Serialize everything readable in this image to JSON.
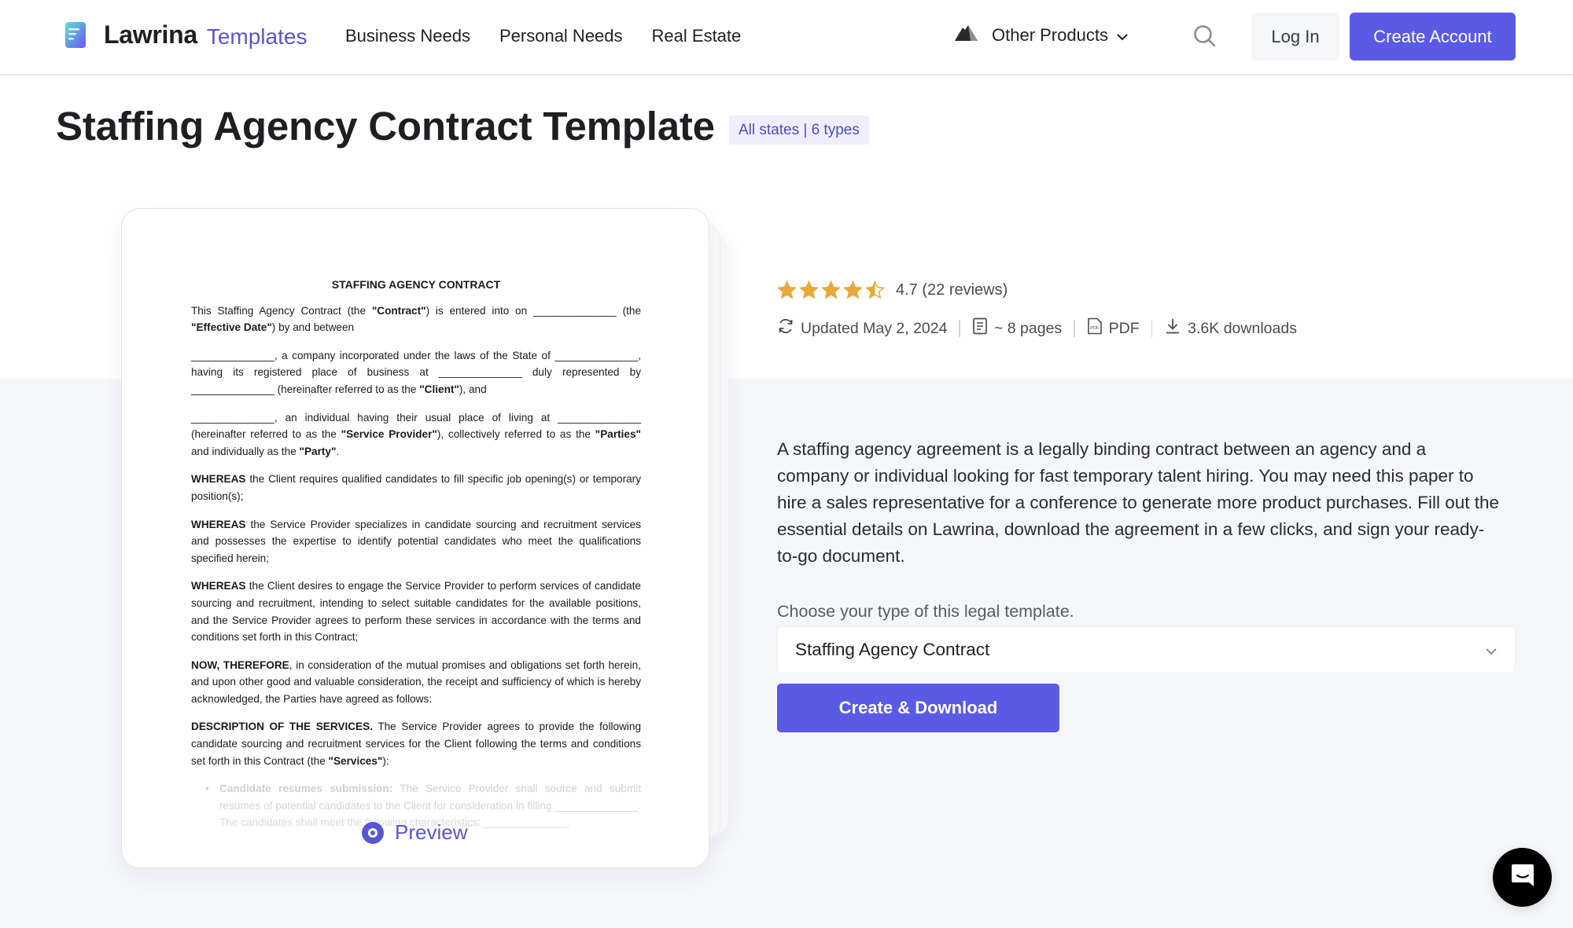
{
  "header": {
    "brand": "Lawrina",
    "brand_sub": "Templates",
    "nav": [
      "Business Needs",
      "Personal Needs",
      "Real Estate"
    ],
    "other_products": "Other Products",
    "login": "Log In",
    "create_account": "Create Account",
    "icons": {
      "logo": "document-logo-icon",
      "other_products": "mountain-icon",
      "chevron": "chevron-down-icon",
      "search": "search-icon"
    }
  },
  "page": {
    "title": "Staffing Agency Contract Template",
    "badge": "All states | 6 types"
  },
  "document_preview": {
    "title": "STAFFING AGENCY CONTRACT",
    "paragraphs": [
      "This Staffing Agency Contract (the \"Contract\") is entered into on ______________ (the \"Effective Date\") by and between",
      "______________, a company incorporated under the laws of the State of ______________, having its registered place of business at ______________ duly represented by ______________ (hereinafter referred to as the \"Client\"), and",
      "______________, an individual having their usual place of living at ______________ (hereinafter referred to as the \"Service Provider\"), collectively referred to as the \"Parties\" and individually as the \"Party\".",
      "WHEREAS the Client requires qualified candidates to fill specific job opening(s) or temporary position(s);",
      "WHEREAS the Service Provider specializes in candidate sourcing and recruitment services and possesses the expertise to identify potential candidates who meet the qualifications specified herein;",
      "WHEREAS the Client desires to engage the Service Provider to perform services of candidate sourcing and recruitment, intending to select suitable candidates for the available positions, and the Service Provider agrees to perform these services in accordance with the terms and conditions set forth in this Contract;",
      "NOW, THEREFORE, in consideration of the mutual promises and obligations set forth herein, and upon other good and valuable consideration, the receipt and sufficiency of which is hereby acknowledged, the Parties have agreed as follows:",
      "DESCRIPTION OF THE SERVICES. The Service Provider agrees to provide the following candidate sourcing and recruitment services for the Client following the terms and conditions set forth in this Contract (the \"Services\"):"
    ],
    "bullet_label": "Candidate resumes submission:",
    "bullet_text": "The Service Provider shall source and submit resumes of potential candidates to the Client for consideration in filling ______________. The candidates shall meet the following characteristics: ______________.",
    "preview_label": "Preview",
    "preview_icon": "eye-icon"
  },
  "rating": {
    "value": 4.7,
    "max": 5,
    "text": "4.7 (22 reviews)",
    "star_color": "#e8a93a"
  },
  "meta": {
    "updated": "Updated May 2, 2024",
    "pages": "~ 8 pages",
    "format": "PDF",
    "downloads": "3.6K downloads"
  },
  "description": "A staffing agency agreement is a legally binding contract between an agency and a company or individual looking for fast temporary talent hiring. You may need this paper to hire a sales representative for a conference to generate more product purchases. Fill out the essential details on Lawrina, download the agreement in a few clicks, and sign your ready-to-go document.",
  "type_selector": {
    "label": "Choose your type of this legal template.",
    "selected": "Staffing Agency Contract"
  },
  "actions": {
    "download": "Create & Download"
  },
  "colors": {
    "accent": "#5a5ae6",
    "brand_sub": "#5a56c8",
    "band_bg": "#f5f6fa"
  },
  "chat": {
    "icon": "chat-icon"
  }
}
